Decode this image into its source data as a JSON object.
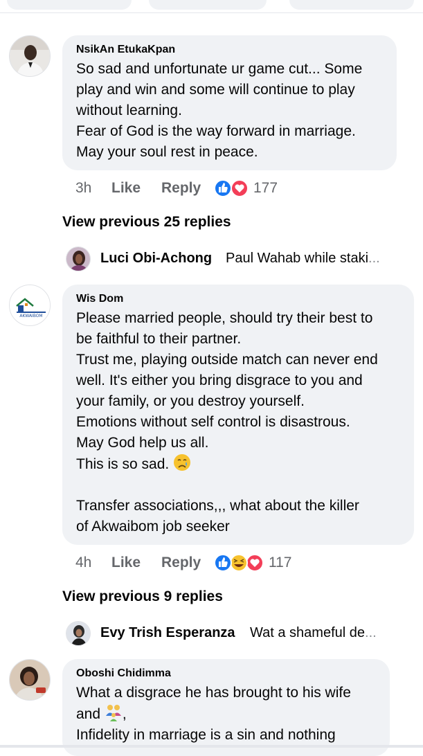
{
  "comments": [
    {
      "author": "NsikAn EtukaKpan",
      "lines": [
        "So sad and unfortunate ur game cut... Some",
        "play and win and some will continue to play",
        "without learning.",
        "Fear of God is the way forward in marriage.",
        "May your soul rest in peace."
      ],
      "time": "3h",
      "like_label": "Like",
      "reply_label": "Reply",
      "reactions": [
        "like-icon",
        "love-icon"
      ],
      "reaction_count": "177",
      "view_previous": "View previous 25 replies",
      "latest_reply": {
        "name": "Luci Obi-Achong",
        "text": "Paul Wahab while staki",
        "ellipsis": "..."
      }
    },
    {
      "author": "Wis Dom",
      "lines": [
        "Please married people,  should try their best to",
        "be faithful to their partner.",
        "Trust me, playing outside match can never end",
        "well. It's either you bring disgrace to you and",
        "your family, or you destroy yourself.",
        "Emotions without self control is disastrous.",
        "May God help us all.",
        "This is so sad.",
        "",
        "Transfer associations,,, what about the killer",
        "of Akwaibom job seeker"
      ],
      "emoji_after_line_8": "crying-face-icon",
      "time": "4h",
      "like_label": "Like",
      "reply_label": "Reply",
      "reactions": [
        "like-icon",
        "haha-icon",
        "love-icon"
      ],
      "reaction_count": "117",
      "view_previous": "View previous 9 replies",
      "latest_reply": {
        "name": "Evy Trish Esperanza",
        "text": "Wat a shameful de",
        "ellipsis": "..."
      }
    },
    {
      "author": "Oboshi Chidimma",
      "lines": [
        "What a disgrace he has brought to his wife",
        "and",
        "Infidelity in marriage is a sin and nothing"
      ],
      "emoji_after_line_2": "family-icon",
      "trailing_comma": ","
    }
  ],
  "wisdom_logo_text": "AKWAIBOM"
}
